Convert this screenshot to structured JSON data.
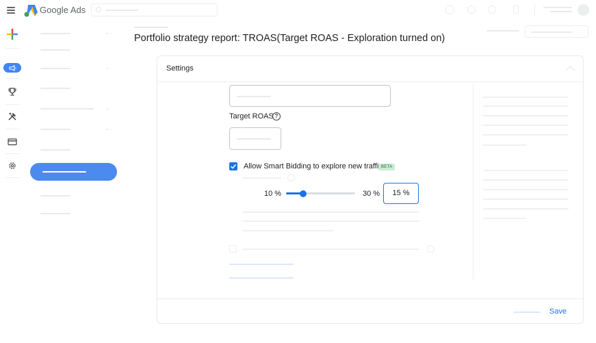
{
  "app": {
    "brand": "Google Ads"
  },
  "page": {
    "title": "Portfolio strategy report: TROAS(Target ROAS - Exploration turned on)"
  },
  "settings": {
    "header": "Settings",
    "target_roas_label": "Target ROAS",
    "help_glyph": "?",
    "explore_checked": true,
    "explore_label": "Allow Smart Bidding to explore new traffic",
    "beta_badge": "BETA",
    "slider": {
      "min_label": "10 %",
      "max_label": "30 %",
      "value": 15,
      "value_label": "15 %"
    },
    "save_label": "Save"
  },
  "colors": {
    "accent": "#1a73e8",
    "nav_active": "#4d8af0",
    "beta_bg": "#ceead6",
    "beta_text": "#137333"
  },
  "icons": {
    "menu": "menu-icon",
    "logo": "google-ads-logo",
    "search": "search-icon",
    "create": "plus-icon",
    "campaigns": "megaphone-icon",
    "goals": "trophy-icon",
    "tools": "tools-icon",
    "billing": "credit-card-icon",
    "admin": "gear-icon",
    "help": "help-circle-icon",
    "check": "check-icon"
  }
}
